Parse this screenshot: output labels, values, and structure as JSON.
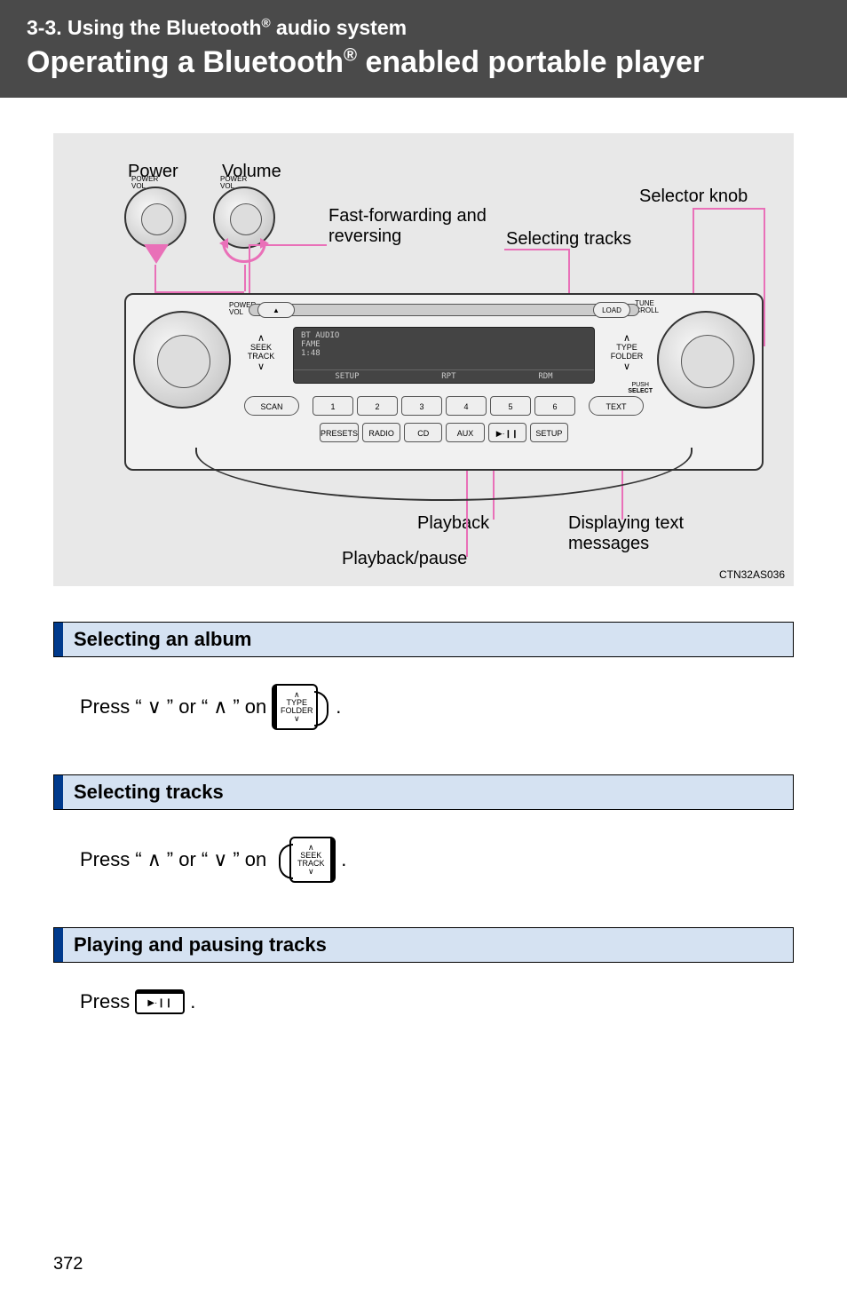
{
  "header": {
    "section_number": "3-3. Using the Bluetooth",
    "section_suffix": " audio system",
    "title_prefix": "Operating a Bluetooth",
    "title_suffix": " enabled portable player",
    "reg_mark": "®"
  },
  "diagram": {
    "labels": {
      "power": "Power",
      "volume": "Volume",
      "fast_forward": "Fast-forwarding and reversing",
      "selecting_tracks": "Selecting tracks",
      "selector_knob": "Selector knob",
      "playback": "Playback",
      "playback_pause": "Playback/pause",
      "displaying_text": "Displaying text messages"
    },
    "unit": {
      "power_vol": "POWER\nVOL",
      "tune_scroll": "TUNE\nSCROLL",
      "load": "LOAD",
      "eject": "▲",
      "seek": "SEEK\nTRACK",
      "type": "TYPE\nFOLDER",
      "push_select": "PUSH\nSELECT",
      "scan": "SCAN",
      "text": "TEXT",
      "presets": "PRESETS",
      "radio": "RADIO",
      "cd": "CD",
      "aux": "AUX",
      "play": "▶·❙❙",
      "setup": "SETUP",
      "disp_mode": "BT AUDIO",
      "disp_title": "FAME",
      "disp_time": "1:48",
      "disp_btm_setup": "SETUP",
      "disp_rpt": "RPT",
      "disp_rdm": "RDM",
      "nums": [
        "1",
        "2",
        "3",
        "4",
        "5",
        "6"
      ]
    },
    "figure_id": "CTN32AS036"
  },
  "sections": {
    "album": {
      "title": "Selecting an album",
      "body_prefix": "Press “",
      "down": "∨",
      "mid": "” or “",
      "up": "∧",
      "body_suffix": "” on ",
      "icon_labels": {
        "up": "∧",
        "type": "TYPE",
        "folder": "FOLDER",
        "down": "∨"
      }
    },
    "tracks": {
      "title": "Selecting tracks",
      "body_prefix": "Press “",
      "up": "∧",
      "mid": "” or “",
      "down": "∨",
      "body_suffix": "” on ",
      "icon_labels": {
        "up": "∧",
        "seek": "SEEK",
        "track": "TRACK",
        "down": "∨"
      }
    },
    "playpause": {
      "title": "Playing and pausing tracks",
      "body": "Press ",
      "icon_label": "▶·❙❙"
    }
  },
  "page_number": "372",
  "period": "."
}
